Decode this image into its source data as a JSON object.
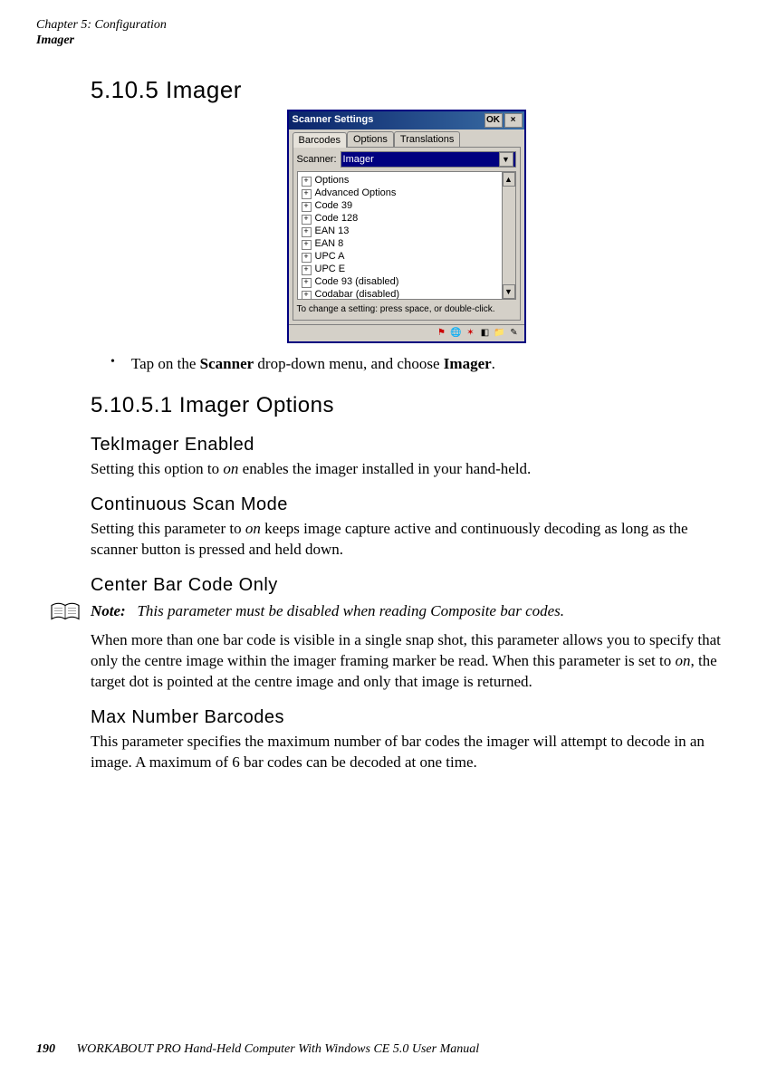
{
  "header": {
    "chapter_line": "Chapter 5: Configuration",
    "section_line": "Imager"
  },
  "section_heading": "5.10.5  Imager",
  "win": {
    "title": "Scanner Settings",
    "ok": "OK",
    "close": "×",
    "tabs": {
      "barcodes": "Barcodes",
      "options": "Options",
      "translations": "Translations"
    },
    "scanner_label": "Scanner:",
    "scanner_value": "Imager",
    "tree": [
      "Options",
      "Advanced Options",
      "Code 39",
      "Code 128",
      "EAN 13",
      "EAN 8",
      "UPC A",
      "UPC E",
      "Code 93 (disabled)",
      "Codabar (disabled)"
    ],
    "hint": "To change a setting: press space, or double-click."
  },
  "bullet_text_pre": "Tap on the ",
  "bullet_text_b1": "Scanner",
  "bullet_text_mid": " drop-down menu, and choose ",
  "bullet_text_b2": "Imager",
  "bullet_text_post": ".",
  "h2_options": "5.10.5.1  Imager Options",
  "tek_h": "TekImager Enabled",
  "tek_p_pre": "Setting this option to ",
  "tek_p_i": "on",
  "tek_p_post": " enables the imager installed in your hand-held.",
  "cont_h": "Continuous Scan Mode",
  "cont_p_pre": "Setting this parameter to ",
  "cont_p_i": "on",
  "cont_p_post": " keeps image capture active and continuously decoding as long as the scanner button is pressed and held down.",
  "center_h": "Center Bar Code Only",
  "note_label": "Note:",
  "note_body": "This parameter must be disabled when reading Composite bar codes.",
  "center_p_pre": "When more than one bar code is visible in a single snap shot, this parameter allows you to specify that only the centre image within the imager framing marker be read. When this parameter is set to ",
  "center_p_i": "on",
  "center_p_post": ", the target dot is pointed at the centre image and only that image is returned.",
  "max_h": "Max Number Barcodes",
  "max_p": "This parameter specifies the maximum number of bar codes the imager will attempt to decode in an image. A maximum of 6 bar codes can be decoded at one time.",
  "footer": {
    "page": "190",
    "title": "WORKABOUT PRO Hand-Held Computer With Windows CE 5.0 User Manual"
  }
}
